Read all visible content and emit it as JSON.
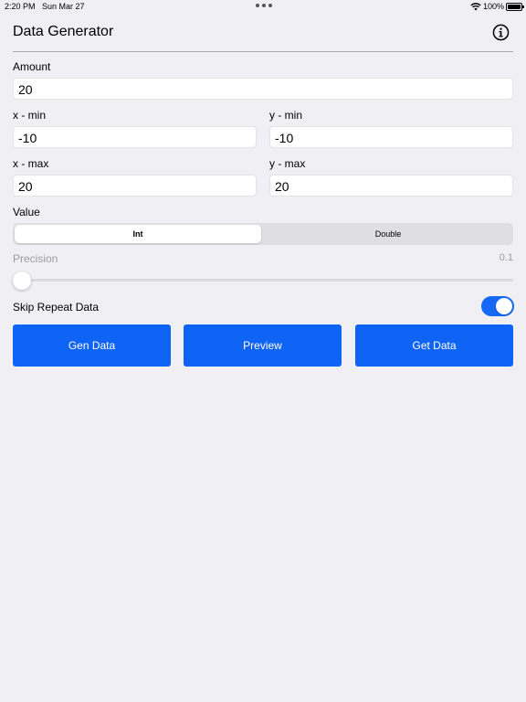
{
  "status_bar": {
    "time": "2:20 PM",
    "date": "Sun Mar 27",
    "battery": "100%"
  },
  "header": {
    "title": "Data Generator",
    "info_icon": "info-circle-icon"
  },
  "form": {
    "amount_label": "Amount",
    "amount_value": "20",
    "x_min_label": "x - min",
    "x_min_value": "-10",
    "y_min_label": "y - min",
    "y_min_value": "-10",
    "x_max_label": "x - max",
    "x_max_value": "20",
    "y_max_label": "y - max",
    "y_max_value": "20",
    "value_label": "Value",
    "value_options": [
      "Int",
      "Double"
    ],
    "value_selected": "Int",
    "precision_label": "Precision",
    "precision_value": "0.1",
    "precision_slider_fraction": 0,
    "skip_repeat_label": "Skip Repeat Data",
    "skip_repeat_on": true
  },
  "actions": {
    "gen_data_label": "Gen Data",
    "preview_label": "Preview",
    "get_data_label": "Get Data"
  },
  "colors": {
    "accent": "#0f63f5",
    "background": "#efeff4",
    "toggle_on": "#1569f6"
  }
}
